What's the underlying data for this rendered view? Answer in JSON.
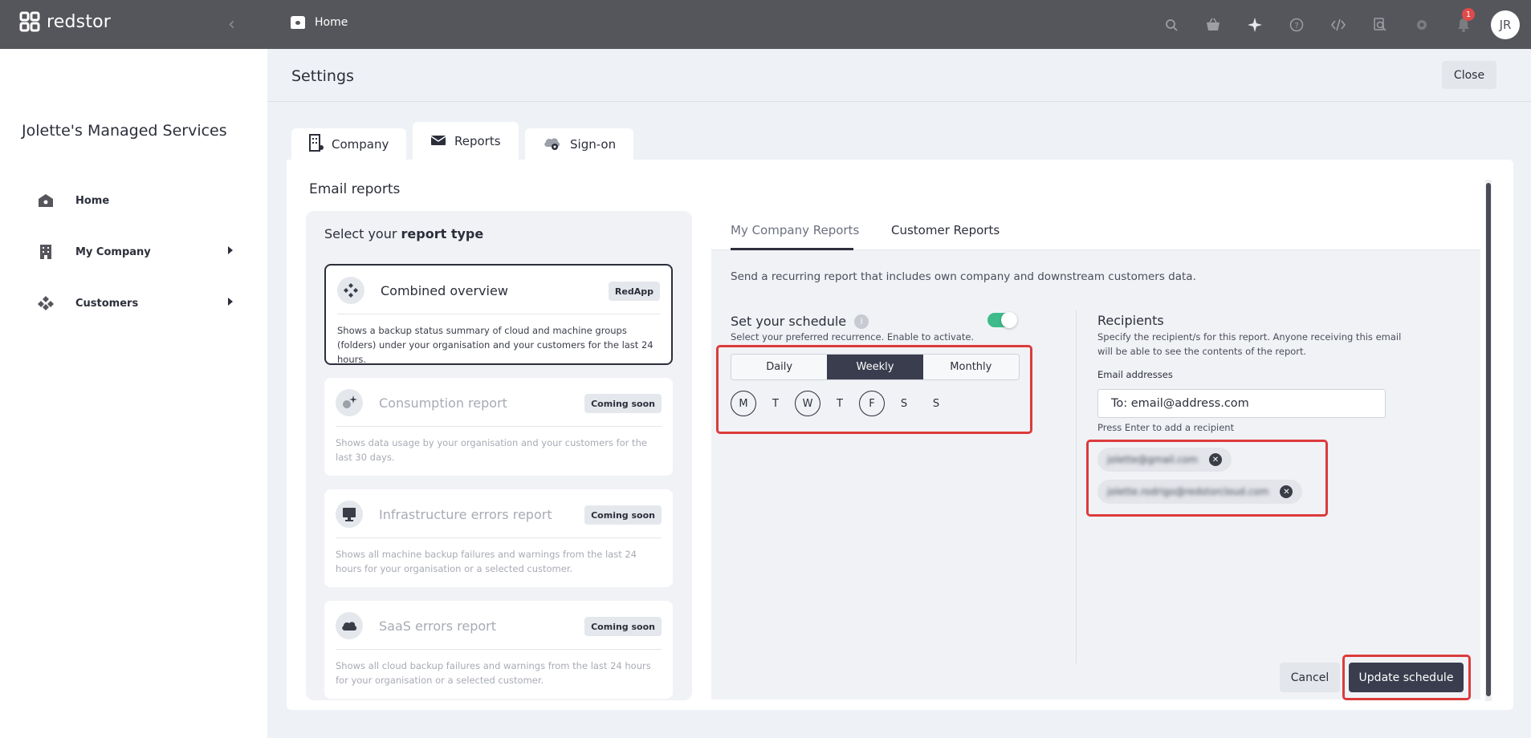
{
  "topbar": {
    "brand": "redstor",
    "breadcrumb": "Home",
    "notifications_count": "1",
    "user_initials": "JR",
    "icons": [
      "search-icon",
      "basket-icon",
      "sparkle-icon",
      "help-icon",
      "code-icon",
      "inspect-icon",
      "gear-icon",
      "bell-icon"
    ]
  },
  "sidebar": {
    "org_name": "Jolette's Managed Services",
    "items": [
      {
        "label": "Home",
        "icon": "home-icon",
        "expandable": false
      },
      {
        "label": "My Company",
        "icon": "building-icon",
        "expandable": true
      },
      {
        "label": "Customers",
        "icon": "customers-icon",
        "expandable": true
      }
    ]
  },
  "page": {
    "title": "Settings",
    "close_label": "Close"
  },
  "tabs": [
    {
      "label": "Company",
      "icon": "building-icon",
      "active": false
    },
    {
      "label": "Reports",
      "icon": "envelope-icon",
      "active": true
    },
    {
      "label": "Sign-on",
      "icon": "cloud-key-icon",
      "active": false
    }
  ],
  "email_reports": {
    "heading": "Email reports",
    "select_prefix": "Select your ",
    "select_bold": "report type",
    "cards": [
      {
        "title": "Combined overview",
        "pill": "RedApp",
        "desc": "Shows a backup status summary of cloud and machine groups (folders) under your organisation and your customers for the last 24 hours.",
        "icon": "diamonds-icon",
        "selected": true
      },
      {
        "title": "Consumption report",
        "pill": "Coming soon",
        "desc": "Shows data usage by your organisation and your customers for the last 30 days.",
        "icon": "sparkle-icon",
        "selected": false
      },
      {
        "title": "Infrastructure errors report",
        "pill": "Coming soon",
        "desc": "Shows all machine backup failures and warnings from the last 24 hours for your organisation or a selected customer.",
        "icon": "monitor-icon",
        "selected": false
      },
      {
        "title": "SaaS errors report",
        "pill": "Coming soon",
        "desc": "Shows all cloud backup failures and warnings from the last 24 hours for your organisation or a selected customer.",
        "icon": "cloud-icon",
        "selected": false
      }
    ]
  },
  "subtabs": [
    {
      "label": "My Company Reports",
      "active": true
    },
    {
      "label": "Customer Reports",
      "active": false
    }
  ],
  "schedule": {
    "description": "Send a recurring report that includes own company and downstream customers data.",
    "title": "Set your schedule",
    "info": "i",
    "subtitle": "Select your preferred recurrence. Enable to activate.",
    "enabled": true,
    "recurrence_options": [
      "Daily",
      "Weekly",
      "Monthly"
    ],
    "recurrence_selected": "Weekly",
    "days": [
      {
        "label": "M",
        "on": true
      },
      {
        "label": "T",
        "on": false
      },
      {
        "label": "W",
        "on": true
      },
      {
        "label": "T",
        "on": false
      },
      {
        "label": "F",
        "on": true
      },
      {
        "label": "S",
        "on": false
      },
      {
        "label": "S",
        "on": false
      }
    ]
  },
  "recipients": {
    "title": "Recipients",
    "description": "Specify the recipient/s for this report. Anyone receiving this email will be able to see the contents of the report.",
    "email_label": "Email addresses",
    "email_placeholder": "To: email@address.com",
    "hint": "Press Enter to add a recipient",
    "chips": [
      "jolette@gmail.com",
      "jolette.rodrigo@redstorcloud.com"
    ]
  },
  "actions": {
    "cancel": "Cancel",
    "update": "Update schedule"
  },
  "colors": {
    "topbar": "#55565b",
    "primary_dark": "#3a3d4e",
    "toggle_on": "#3dbb8a",
    "highlight": "#dc3b3b",
    "badge": "#e04a4a"
  }
}
